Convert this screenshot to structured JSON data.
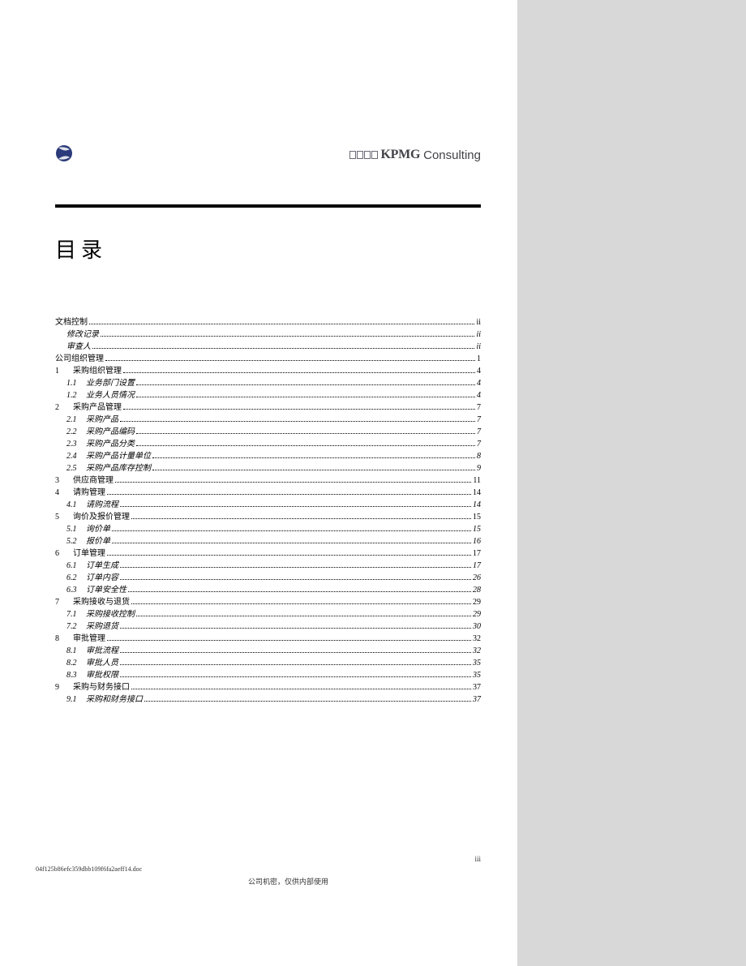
{
  "brand": {
    "kpmg": "KPMG",
    "consulting": "Consulting"
  },
  "title": "目录",
  "toc": [
    {
      "lvl": "lvl0",
      "num": "",
      "label": "文档控制",
      "page": "ii"
    },
    {
      "lvl": "lvl0i",
      "num": "",
      "label": "修改记录",
      "page": "ii"
    },
    {
      "lvl": "lvl0i",
      "num": "",
      "label": "审查人",
      "page": "ii"
    },
    {
      "lvl": "lvl0",
      "num": "",
      "label": "公司组织管理",
      "page": "1"
    },
    {
      "lvl": "lvl1",
      "num": "1",
      "label": "采购组织管理",
      "page": "4"
    },
    {
      "lvl": "lvl2",
      "num": "1.1",
      "label": "业务部门设置",
      "page": "4"
    },
    {
      "lvl": "lvl2",
      "num": "1.2",
      "label": "业务人员情况",
      "page": "4"
    },
    {
      "lvl": "lvl1",
      "num": "2",
      "label": "采购产品管理",
      "page": "7"
    },
    {
      "lvl": "lvl2",
      "num": "2.1",
      "label": "采购产品",
      "page": "7"
    },
    {
      "lvl": "lvl2",
      "num": "2.2",
      "label": "采购产品编码",
      "page": "7"
    },
    {
      "lvl": "lvl2",
      "num": "2.3",
      "label": "采购产品分类",
      "page": "7"
    },
    {
      "lvl": "lvl2",
      "num": "2.4",
      "label": "采购产品计量单位",
      "page": "8"
    },
    {
      "lvl": "lvl2",
      "num": "2.5",
      "label": "采购产品库存控制",
      "page": "9"
    },
    {
      "lvl": "lvl1",
      "num": "3",
      "label": "供应商管理",
      "page": "11"
    },
    {
      "lvl": "lvl1",
      "num": "4",
      "label": "请购管理",
      "page": "14"
    },
    {
      "lvl": "lvl2",
      "num": "4.1",
      "label": "请购流程",
      "page": "14"
    },
    {
      "lvl": "lvl1",
      "num": "5",
      "label": "询价及报价管理",
      "page": "15"
    },
    {
      "lvl": "lvl2",
      "num": "5.1",
      "label": "询价单",
      "page": "15"
    },
    {
      "lvl": "lvl2",
      "num": "5.2",
      "label": "报价单",
      "page": "16"
    },
    {
      "lvl": "lvl1",
      "num": "6",
      "label": "订单管理",
      "page": "17"
    },
    {
      "lvl": "lvl2",
      "num": "6.1",
      "label": "订单生成",
      "page": "17"
    },
    {
      "lvl": "lvl2",
      "num": "6.2",
      "label": "订单内容",
      "page": "26"
    },
    {
      "lvl": "lvl2",
      "num": "6.3",
      "label": "订单安全性",
      "page": "28"
    },
    {
      "lvl": "lvl1",
      "num": "7",
      "label": "采购接收与退货",
      "page": "29"
    },
    {
      "lvl": "lvl2",
      "num": "7.1",
      "label": "采购接收控制",
      "page": "29"
    },
    {
      "lvl": "lvl2",
      "num": "7.2",
      "label": "采购退货",
      "page": "30"
    },
    {
      "lvl": "lvl1",
      "num": "8",
      "label": "审批管理",
      "page": "32"
    },
    {
      "lvl": "lvl2",
      "num": "8.1",
      "label": "审批流程",
      "page": "32"
    },
    {
      "lvl": "lvl2",
      "num": "8.2",
      "label": "审批人员",
      "page": "35"
    },
    {
      "lvl": "lvl2",
      "num": "8.3",
      "label": "审批权限",
      "page": "35"
    },
    {
      "lvl": "lvl1",
      "num": "9",
      "label": "采购与财务接口",
      "page": "37"
    },
    {
      "lvl": "lvl2",
      "num": "9.1",
      "label": "采购和财务接口",
      "page": "37"
    }
  ],
  "footer": {
    "filename": "04f125b86efc359dbb109f6fa2aeff14.doc",
    "confidential": "公司机密，仅供内部使用",
    "pagenum": "iii"
  }
}
